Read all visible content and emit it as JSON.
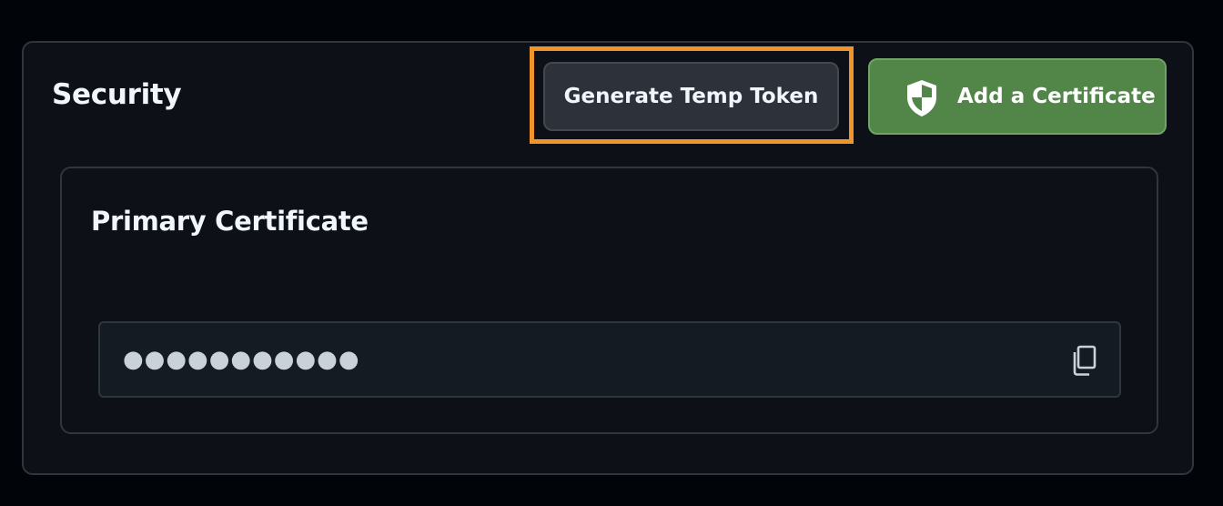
{
  "security": {
    "title": "Security",
    "generate_token_label": "Generate Temp Token",
    "add_certificate_label": "Add a Certificate"
  },
  "certificate": {
    "title": "Primary Certificate",
    "masked_value": "●●●●●●●●●●●"
  },
  "icons": {
    "add_certificate": "shield-icon",
    "copy": "copy-icon"
  },
  "colors": {
    "background": "#010409",
    "panel": "#0d1117",
    "border": "#30363d",
    "highlight": "#f0952a",
    "primary_button": "#528548",
    "secondary_button": "#2d3139"
  }
}
